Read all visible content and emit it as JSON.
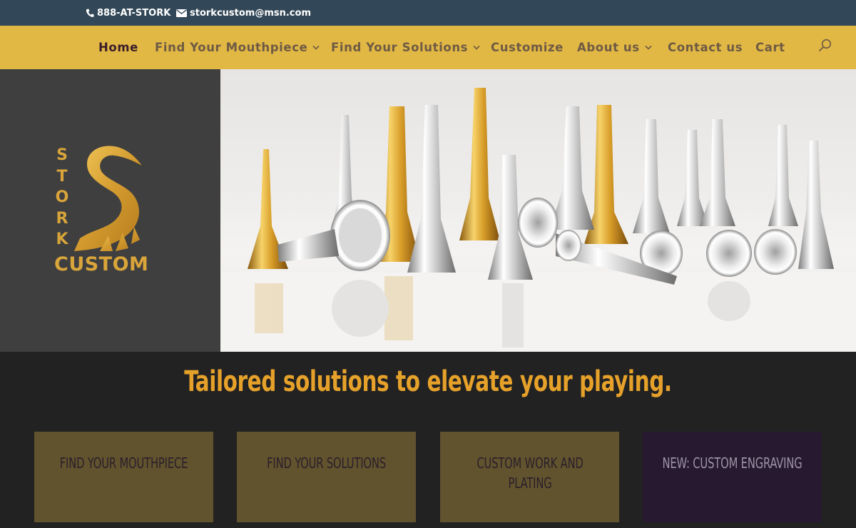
{
  "topbar": {
    "phone": "888-AT-STORK",
    "phone_icon": "phone-icon",
    "email": "storkcustom@msn.com",
    "email_icon": "envelope-icon"
  },
  "nav": {
    "items": [
      {
        "label": "Home",
        "active": true
      },
      {
        "label": "Find Your Mouthpiece",
        "dropdown": true
      },
      {
        "label": "Find Your Solutions",
        "dropdown": true
      },
      {
        "label": "Customize"
      },
      {
        "label": "About us",
        "dropdown": true
      },
      {
        "label": "Contact us"
      },
      {
        "label": "Cart"
      }
    ],
    "search_icon": "search-icon"
  },
  "logo": {
    "letters": [
      "S",
      "T",
      "O",
      "R",
      "K"
    ],
    "word": "CUSTOM"
  },
  "hero": {
    "tagline": "Tailored solutions to elevate your playing."
  },
  "cards": [
    {
      "label": "FIND YOUR MOUTHPIECE"
    },
    {
      "label": "FIND YOUR SOLUTIONS"
    },
    {
      "label": "CUSTOM WORK AND PLATING"
    },
    {
      "label": "NEW: CUSTOM ENGRAVING"
    }
  ],
  "colors": {
    "topbar": "#324757",
    "nav": "#e1b844",
    "gold": "#d9a53a",
    "tagline": "#e6a12a",
    "card": "#61532e",
    "card_purple": "#27192f",
    "page": "#222222"
  }
}
